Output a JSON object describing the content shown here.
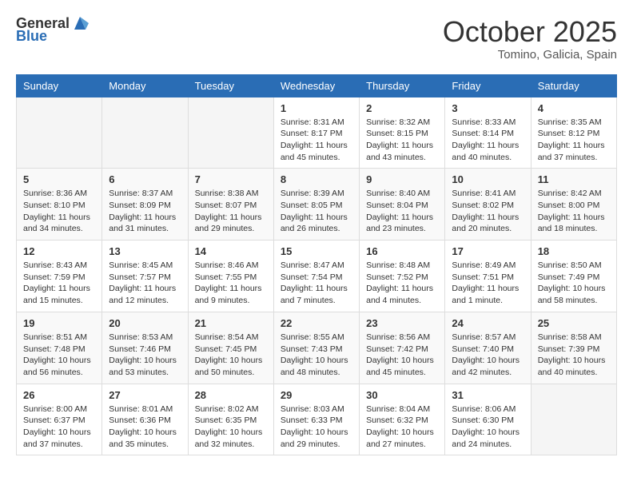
{
  "header": {
    "logo_general": "General",
    "logo_blue": "Blue",
    "month_title": "October 2025",
    "location": "Tomino, Galicia, Spain"
  },
  "calendar": {
    "days_of_week": [
      "Sunday",
      "Monday",
      "Tuesday",
      "Wednesday",
      "Thursday",
      "Friday",
      "Saturday"
    ],
    "weeks": [
      [
        {
          "day": "",
          "info": ""
        },
        {
          "day": "",
          "info": ""
        },
        {
          "day": "",
          "info": ""
        },
        {
          "day": "1",
          "info": "Sunrise: 8:31 AM\nSunset: 8:17 PM\nDaylight: 11 hours\nand 45 minutes."
        },
        {
          "day": "2",
          "info": "Sunrise: 8:32 AM\nSunset: 8:15 PM\nDaylight: 11 hours\nand 43 minutes."
        },
        {
          "day": "3",
          "info": "Sunrise: 8:33 AM\nSunset: 8:14 PM\nDaylight: 11 hours\nand 40 minutes."
        },
        {
          "day": "4",
          "info": "Sunrise: 8:35 AM\nSunset: 8:12 PM\nDaylight: 11 hours\nand 37 minutes."
        }
      ],
      [
        {
          "day": "5",
          "info": "Sunrise: 8:36 AM\nSunset: 8:10 PM\nDaylight: 11 hours\nand 34 minutes."
        },
        {
          "day": "6",
          "info": "Sunrise: 8:37 AM\nSunset: 8:09 PM\nDaylight: 11 hours\nand 31 minutes."
        },
        {
          "day": "7",
          "info": "Sunrise: 8:38 AM\nSunset: 8:07 PM\nDaylight: 11 hours\nand 29 minutes."
        },
        {
          "day": "8",
          "info": "Sunrise: 8:39 AM\nSunset: 8:05 PM\nDaylight: 11 hours\nand 26 minutes."
        },
        {
          "day": "9",
          "info": "Sunrise: 8:40 AM\nSunset: 8:04 PM\nDaylight: 11 hours\nand 23 minutes."
        },
        {
          "day": "10",
          "info": "Sunrise: 8:41 AM\nSunset: 8:02 PM\nDaylight: 11 hours\nand 20 minutes."
        },
        {
          "day": "11",
          "info": "Sunrise: 8:42 AM\nSunset: 8:00 PM\nDaylight: 11 hours\nand 18 minutes."
        }
      ],
      [
        {
          "day": "12",
          "info": "Sunrise: 8:43 AM\nSunset: 7:59 PM\nDaylight: 11 hours\nand 15 minutes."
        },
        {
          "day": "13",
          "info": "Sunrise: 8:45 AM\nSunset: 7:57 PM\nDaylight: 11 hours\nand 12 minutes."
        },
        {
          "day": "14",
          "info": "Sunrise: 8:46 AM\nSunset: 7:55 PM\nDaylight: 11 hours\nand 9 minutes."
        },
        {
          "day": "15",
          "info": "Sunrise: 8:47 AM\nSunset: 7:54 PM\nDaylight: 11 hours\nand 7 minutes."
        },
        {
          "day": "16",
          "info": "Sunrise: 8:48 AM\nSunset: 7:52 PM\nDaylight: 11 hours\nand 4 minutes."
        },
        {
          "day": "17",
          "info": "Sunrise: 8:49 AM\nSunset: 7:51 PM\nDaylight: 11 hours\nand 1 minute."
        },
        {
          "day": "18",
          "info": "Sunrise: 8:50 AM\nSunset: 7:49 PM\nDaylight: 10 hours\nand 58 minutes."
        }
      ],
      [
        {
          "day": "19",
          "info": "Sunrise: 8:51 AM\nSunset: 7:48 PM\nDaylight: 10 hours\nand 56 minutes."
        },
        {
          "day": "20",
          "info": "Sunrise: 8:53 AM\nSunset: 7:46 PM\nDaylight: 10 hours\nand 53 minutes."
        },
        {
          "day": "21",
          "info": "Sunrise: 8:54 AM\nSunset: 7:45 PM\nDaylight: 10 hours\nand 50 minutes."
        },
        {
          "day": "22",
          "info": "Sunrise: 8:55 AM\nSunset: 7:43 PM\nDaylight: 10 hours\nand 48 minutes."
        },
        {
          "day": "23",
          "info": "Sunrise: 8:56 AM\nSunset: 7:42 PM\nDaylight: 10 hours\nand 45 minutes."
        },
        {
          "day": "24",
          "info": "Sunrise: 8:57 AM\nSunset: 7:40 PM\nDaylight: 10 hours\nand 42 minutes."
        },
        {
          "day": "25",
          "info": "Sunrise: 8:58 AM\nSunset: 7:39 PM\nDaylight: 10 hours\nand 40 minutes."
        }
      ],
      [
        {
          "day": "26",
          "info": "Sunrise: 8:00 AM\nSunset: 6:37 PM\nDaylight: 10 hours\nand 37 minutes."
        },
        {
          "day": "27",
          "info": "Sunrise: 8:01 AM\nSunset: 6:36 PM\nDaylight: 10 hours\nand 35 minutes."
        },
        {
          "day": "28",
          "info": "Sunrise: 8:02 AM\nSunset: 6:35 PM\nDaylight: 10 hours\nand 32 minutes."
        },
        {
          "day": "29",
          "info": "Sunrise: 8:03 AM\nSunset: 6:33 PM\nDaylight: 10 hours\nand 29 minutes."
        },
        {
          "day": "30",
          "info": "Sunrise: 8:04 AM\nSunset: 6:32 PM\nDaylight: 10 hours\nand 27 minutes."
        },
        {
          "day": "31",
          "info": "Sunrise: 8:06 AM\nSunset: 6:30 PM\nDaylight: 10 hours\nand 24 minutes."
        },
        {
          "day": "",
          "info": ""
        }
      ]
    ]
  }
}
